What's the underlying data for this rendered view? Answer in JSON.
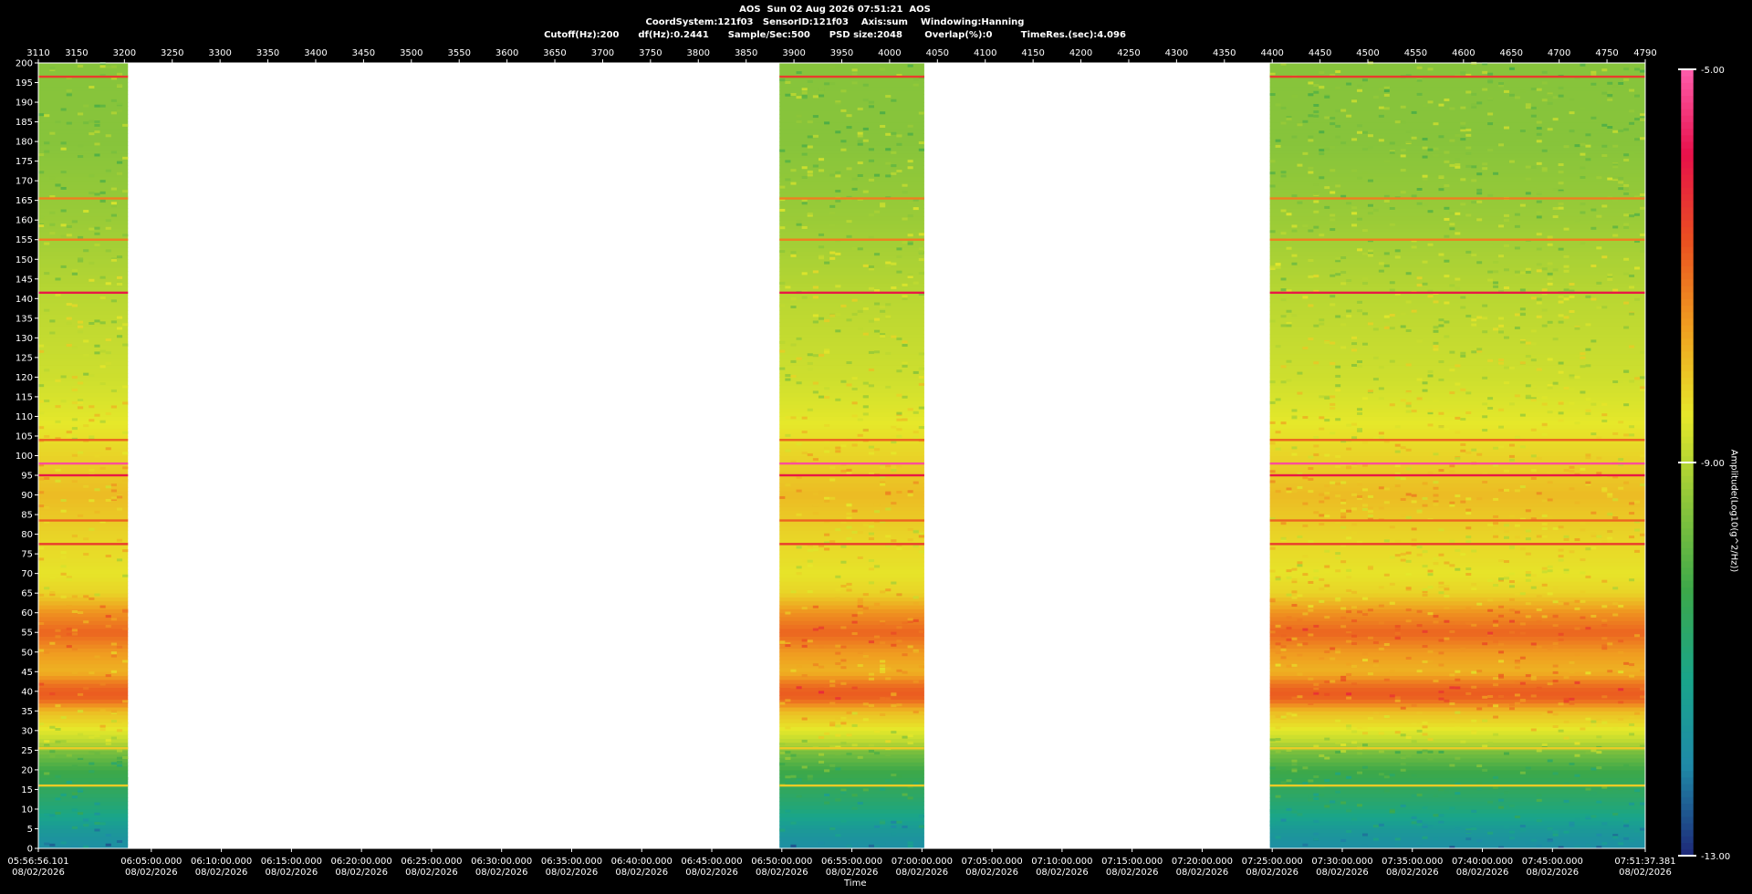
{
  "header": {
    "line1": "AOS  Sun 02 Aug 2026 07:51:21  AOS",
    "line2": "CoordSystem:121f03   SensorID:121f03    Axis:sum    Windowing:Hanning",
    "line3": "Cutoff(Hz):200      df(Hz):0.2441      Sample/Sec:500      PSD size:2048       Overlap(%):0         TimeRes.(sec):4.096"
  },
  "chart_data": {
    "type": "heatmap",
    "title": "AOS  Sun 02 Aug 2026 07:51:21  AOS",
    "xlabel": "Time",
    "ylabel": "",
    "colorbar_label": "Amplitude(Log10(g^2/Hz))",
    "colorbar_ticks": [
      "-5.00",
      "-9.00",
      "-13.00"
    ],
    "colorbar_range": [
      -13,
      -5
    ],
    "ylim": [
      0,
      200
    ],
    "y_ticks": [
      0,
      5,
      10,
      15,
      20,
      25,
      30,
      35,
      40,
      45,
      50,
      55,
      60,
      65,
      70,
      75,
      80,
      85,
      90,
      95,
      100,
      105,
      110,
      115,
      120,
      125,
      130,
      135,
      140,
      145,
      150,
      155,
      160,
      165,
      170,
      175,
      180,
      185,
      190,
      195,
      200
    ],
    "top_axis_range": [
      3110,
      4790
    ],
    "top_axis_ticks": [
      3110,
      3150,
      3200,
      3250,
      3300,
      3350,
      3400,
      3450,
      3500,
      3550,
      3600,
      3650,
      3700,
      3750,
      3800,
      3850,
      3900,
      3950,
      4000,
      4050,
      4100,
      4150,
      4200,
      4250,
      4300,
      4350,
      4400,
      4450,
      4500,
      4550,
      4600,
      4650,
      4700,
      4750,
      4790
    ],
    "time_ticks": [
      {
        "t": "05:56:56.101",
        "d": "08/02/2026"
      },
      {
        "t": "06:05:00.000",
        "d": "08/02/2026"
      },
      {
        "t": "06:10:00.000",
        "d": "08/02/2026"
      },
      {
        "t": "06:15:00.000",
        "d": "08/02/2026"
      },
      {
        "t": "06:20:00.000",
        "d": "08/02/2026"
      },
      {
        "t": "06:25:00.000",
        "d": "08/02/2026"
      },
      {
        "t": "06:30:00.000",
        "d": "08/02/2026"
      },
      {
        "t": "06:35:00.000",
        "d": "08/02/2026"
      },
      {
        "t": "06:40:00.000",
        "d": "08/02/2026"
      },
      {
        "t": "06:45:00.000",
        "d": "08/02/2026"
      },
      {
        "t": "06:50:00.000",
        "d": "08/02/2026"
      },
      {
        "t": "06:55:00.000",
        "d": "08/02/2026"
      },
      {
        "t": "07:00:00.000",
        "d": "08/02/2026"
      },
      {
        "t": "07:05:00.000",
        "d": "08/02/2026"
      },
      {
        "t": "07:10:00.000",
        "d": "08/02/2026"
      },
      {
        "t": "07:15:00.000",
        "d": "08/02/2026"
      },
      {
        "t": "07:20:00.000",
        "d": "08/02/2026"
      },
      {
        "t": "07:25:00.000",
        "d": "08/02/2026"
      },
      {
        "t": "07:30:00.000",
        "d": "08/02/2026"
      },
      {
        "t": "07:35:00.000",
        "d": "08/02/2026"
      },
      {
        "t": "07:40:00.000",
        "d": "08/02/2026"
      },
      {
        "t": "07:45:00.000",
        "d": "08/02/2026"
      },
      {
        "t": "07:51:37.381",
        "d": "08/02/2026"
      }
    ],
    "time_tick_seconds": [
      21416.101,
      21900,
      22200,
      22500,
      22800,
      23100,
      23400,
      23700,
      24000,
      24300,
      24600,
      24900,
      25200,
      25500,
      25800,
      26100,
      26400,
      26700,
      27000,
      27300,
      27600,
      27900,
      28297.381
    ],
    "data_segments": [
      {
        "start_s": 21416.101,
        "end_s": 21800
      },
      {
        "start_s": 24590,
        "end_s": 25210
      },
      {
        "start_s": 26690,
        "end_s": 28297.381
      }
    ],
    "spectral_profile_log10": [
      [
        0,
        -12.0
      ],
      [
        5,
        -11.6
      ],
      [
        10,
        -11.0
      ],
      [
        15,
        -10.6
      ],
      [
        20,
        -10.3
      ],
      [
        25,
        -9.6
      ],
      [
        27,
        -9.0
      ],
      [
        30,
        -8.6
      ],
      [
        35,
        -8.0
      ],
      [
        38,
        -7.0
      ],
      [
        40,
        -6.9
      ],
      [
        42,
        -7.2
      ],
      [
        45,
        -7.9
      ],
      [
        50,
        -7.6
      ],
      [
        55,
        -7.0
      ],
      [
        60,
        -7.5
      ],
      [
        65,
        -8.3
      ],
      [
        70,
        -8.5
      ],
      [
        80,
        -8.3
      ],
      [
        90,
        -8.0
      ],
      [
        100,
        -8.3
      ],
      [
        110,
        -8.6
      ],
      [
        120,
        -8.8
      ],
      [
        140,
        -9.0
      ],
      [
        160,
        -9.3
      ],
      [
        180,
        -9.5
      ],
      [
        200,
        -9.5
      ]
    ],
    "lines_hz": [
      {
        "hz": 98,
        "level": -5.2
      },
      {
        "hz": 95,
        "level": -6.0
      },
      {
        "hz": 141.5,
        "level": -6.0
      },
      {
        "hz": 196.5,
        "level": -6.5
      },
      {
        "hz": 77.5,
        "level": -6.5
      },
      {
        "hz": 104,
        "level": -7.0
      },
      {
        "hz": 83.5,
        "level": -7.0
      },
      {
        "hz": 165.5,
        "level": -7.3
      },
      {
        "hz": 155,
        "level": -7.3
      },
      {
        "hz": 25.5,
        "level": -8.2
      },
      {
        "hz": 16,
        "level": -8.2
      }
    ]
  },
  "colors": {
    "background": "#000000",
    "empty_region": "#ffffff",
    "colormap": [
      "#1e2b7a",
      "#1f8aa8",
      "#19a58a",
      "#3ca84a",
      "#8cc63a",
      "#e6e82a",
      "#f0a020",
      "#ea5020",
      "#e8104a",
      "#ff60b0"
    ]
  }
}
